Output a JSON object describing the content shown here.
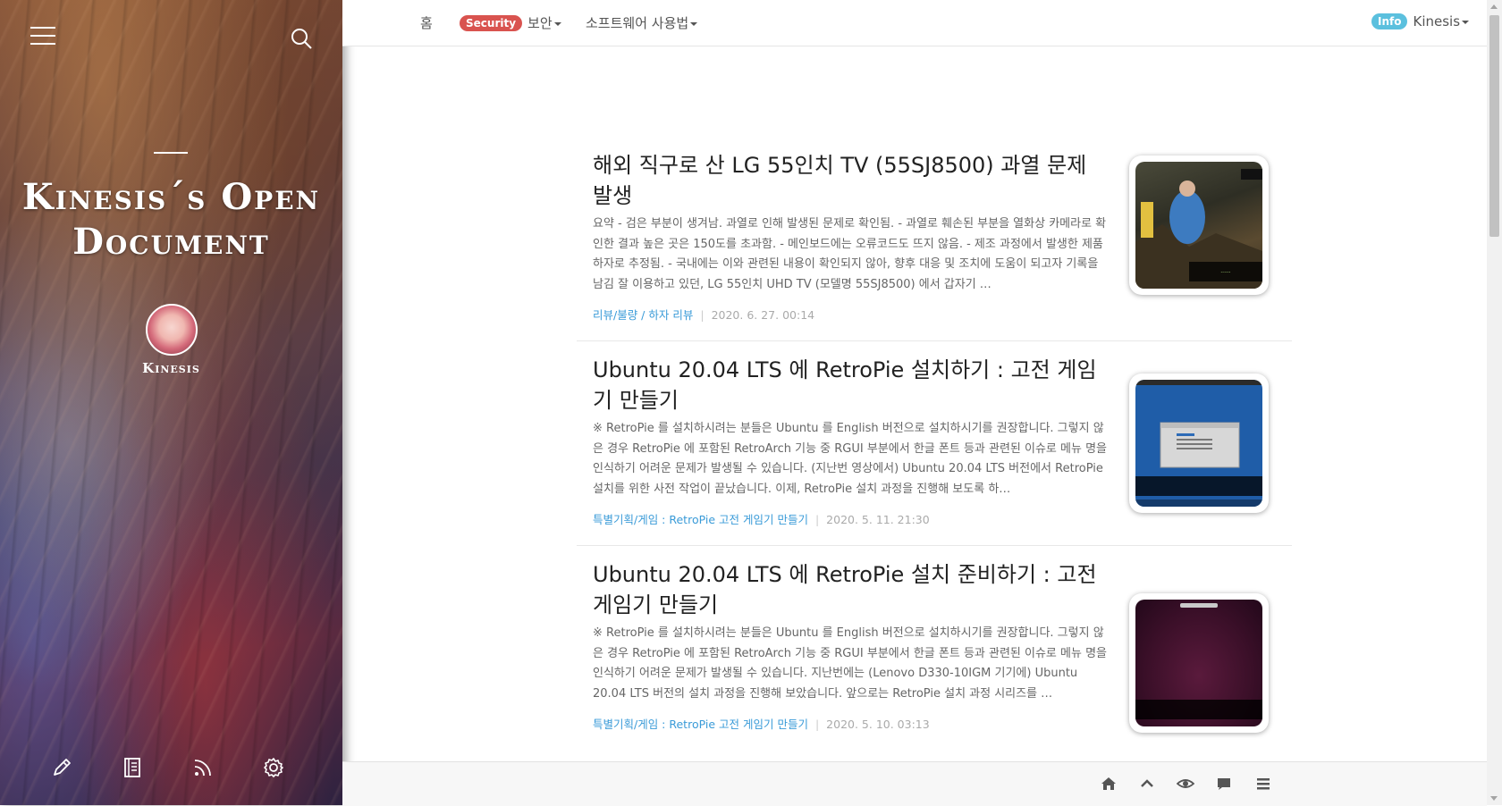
{
  "sidebar": {
    "blog_title": "Kinesis´s Open Document",
    "author_name": "Kinesis",
    "menu_icon": "hamburger-icon",
    "search_icon": "search-icon",
    "tools": [
      "pencil-icon",
      "book-icon",
      "rss-icon",
      "gear-icon"
    ]
  },
  "nav": {
    "home": "홈",
    "security_badge": "Security",
    "security_label": "보안",
    "software_label": "소프트웨어 사용법",
    "info_badge": "Info",
    "user_label": "Kinesis",
    "badge_colors": {
      "security": "#d9534f",
      "info": "#5bc0de"
    }
  },
  "posts": [
    {
      "title": "해외 직구로 산 LG 55인치 TV (55SJ8500) 과열 문제 발생",
      "summary": "요약 - 검은 부분이 생겨남. 과열로 인해 발생된 문제로 확인됨. - 과열로 훼손된 부분을 열화상 카메라로 확인한 결과 높은 곳은 150도를 초과함. - 메인보드에는 오류코드도 뜨지 않음. - 제조 과정에서 발생한 제품 하자로 추정됨. - 국내에는 이와 관련된 내용이 확인되지 않아, 향후 대응 및 조치에 도움이 되고자 기록을 남김 잘 이용하고 있던, LG 55인치 UHD TV (모델명 55SJ8500) 에서 갑자기 …",
      "category": "리뷰/불량 / 하자 리뷰",
      "date": "2020. 6. 27. 00:14",
      "thumb_icon": "tv-review-thumbnail"
    },
    {
      "title": "Ubuntu 20.04 LTS 에 RetroPie 설치하기 : 고전 게임기 만들기",
      "summary": "※ RetroPie 를 설치하시려는 분들은 Ubuntu 를 English 버전으로 설치하시기를 권장합니다. 그렇지 않은 경우 RetroPie 에 포함된 RetroArch 기능 중 RGUI 부분에서 한글 폰트 등과 관련된 이슈로 메뉴 명을 인식하기 어려운 문제가 발생될 수 있습니다. (지난번 영상에서) Ubuntu 20.04 LTS 버전에서 RetroPie 설치를 위한 사전 작업이 끝났습니다. 이제, RetroPie 설치 과정을 진행해 보도록 하…",
      "category": "특별기획/게임 : RetroPie 고전 게임기 만들기",
      "date": "2020. 5. 11. 21:30",
      "thumb_icon": "retropie-setup-thumbnail"
    },
    {
      "title": "Ubuntu 20.04 LTS 에 RetroPie 설치 준비하기 : 고전 게임기 만들기",
      "summary": "※ RetroPie 를 설치하시려는 분들은 Ubuntu 를 English 버전으로 설치하시기를 권장합니다. 그렇지 않은 경우 RetroPie 에 포함된 RetroArch 기능 중 RGUI 부분에서 한글 폰트 등과 관련된 이슈로 메뉴 명을 인식하기 어려운 문제가 발생될 수 있습니다. 지난번에는 (Lenovo D330-10IGM 기기에) Ubuntu 20.04 LTS 버전의 설치 과정을 진행해 보았습니다. 앞으로는 RetroPie 설치 과정 시리즈를 …",
      "category": "특별기획/게임 : RetroPie 고전 게임기 만들기",
      "date": "2020. 5. 10. 03:13",
      "thumb_icon": "ubuntu-terminal-thumbnail"
    }
  ],
  "bottom_bar": [
    "home-icon",
    "chevron-up-icon",
    "eye-icon",
    "comment-icon",
    "list-icon"
  ]
}
